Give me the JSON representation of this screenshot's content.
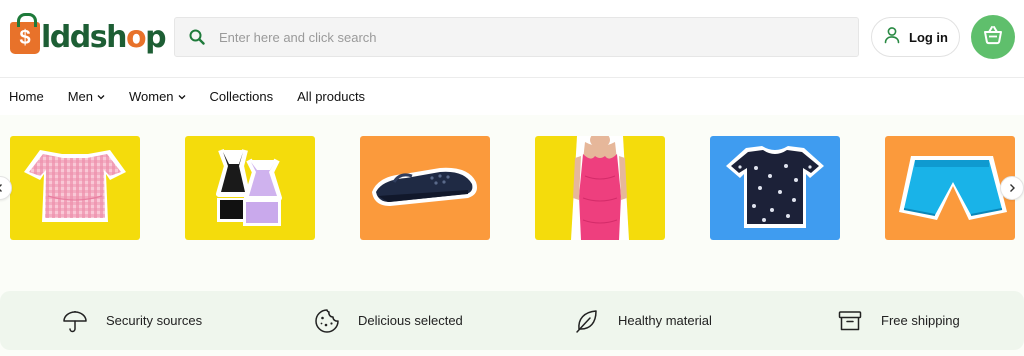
{
  "brand": {
    "logo_text_before": "lddsh",
    "logo_text_accent": "o",
    "logo_text_after": "p",
    "logo_bag_symbol": "$",
    "colors": {
      "green": "#1d5e34",
      "orange": "#e8722a",
      "cart_green": "#5fbf6c"
    }
  },
  "search": {
    "placeholder": "Enter here and click search",
    "icon": "search-icon"
  },
  "login": {
    "label": "Log in",
    "icon": "user-icon"
  },
  "cart": {
    "icon": "basket-icon"
  },
  "nav": {
    "items": [
      {
        "label": "Home",
        "has_dropdown": false
      },
      {
        "label": "Men",
        "has_dropdown": true
      },
      {
        "label": "Women",
        "has_dropdown": true
      },
      {
        "label": "Collections",
        "has_dropdown": false
      },
      {
        "label": "All products",
        "has_dropdown": false
      }
    ]
  },
  "carousel": {
    "products": [
      {
        "name": "pink-gingham-top",
        "bg": "#f4dc0c"
      },
      {
        "name": "lilac-cami-set",
        "bg": "#f4dc0c"
      },
      {
        "name": "navy-clog",
        "bg": "#fb9a3c"
      },
      {
        "name": "pink-bodycon-dress",
        "bg": "#f4dc0c"
      },
      {
        "name": "navy-floral-tee",
        "bg": "#3f9cf0"
      },
      {
        "name": "blue-shorts",
        "bg": "#fb9a3c"
      }
    ]
  },
  "features": [
    {
      "label": "Security sources",
      "icon": "umbrella-icon"
    },
    {
      "label": "Delicious selected",
      "icon": "cookie-icon"
    },
    {
      "label": "Healthy material",
      "icon": "leaf-icon"
    },
    {
      "label": "Free shipping",
      "icon": "box-icon"
    }
  ]
}
